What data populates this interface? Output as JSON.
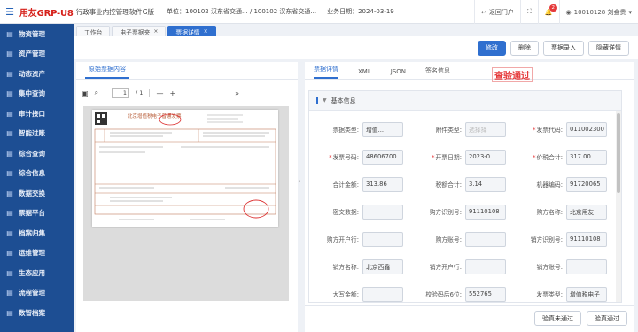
{
  "header": {
    "brand": "用友GRP-U8",
    "system": "行政事业内控管理软件G版",
    "unit": "单位：100102 汉东省交通... / 100102 汉东省交通...",
    "biz_date": "业务日期：2024-03-19",
    "back_portal": "返回门户",
    "notify_count": "2",
    "user": "10010128 刘金贵"
  },
  "sidebar": {
    "items": [
      {
        "label": "物资管理"
      },
      {
        "label": "资产管理"
      },
      {
        "label": "动态资产"
      },
      {
        "label": "集中查询"
      },
      {
        "label": "审计接口"
      },
      {
        "label": "智能过账"
      },
      {
        "label": "综合查询"
      },
      {
        "label": "综合信息"
      },
      {
        "label": "数据交换"
      },
      {
        "label": "票据平台"
      },
      {
        "label": "档案归集"
      },
      {
        "label": "运维管理"
      },
      {
        "label": "生态应用"
      },
      {
        "label": "流程管理"
      },
      {
        "label": "数智档案"
      }
    ]
  },
  "tabs": [
    {
      "label": "工作台"
    },
    {
      "label": "电子票据夹"
    },
    {
      "label": "票据详情"
    }
  ],
  "toolbar": {
    "edit": "修改",
    "delete": "删除",
    "entry": "票据录入",
    "hide": "隐藏详情"
  },
  "left": {
    "tab": "原始票据内容",
    "page_current": "1",
    "page_total": "/ 1"
  },
  "invoice": {
    "title": "北京增值税电子普通发票"
  },
  "right": {
    "tabs": [
      "票据详情",
      "XML",
      "JSON",
      "签名信息"
    ],
    "verify_badge": "查验通过",
    "section": "基本信息",
    "fields": [
      [
        {
          "label": "票据类型:",
          "value": "增值..."
        },
        {
          "label": "附件类型:",
          "value": "选择择",
          "ph": true
        },
        {
          "label": "发票代码:",
          "value": "011002300",
          "req": true
        }
      ],
      [
        {
          "label": "发票号码:",
          "value": "48606700",
          "req": true
        },
        {
          "label": "开票日期:",
          "value": "2023-0",
          "req": true
        },
        {
          "label": "价税合计:",
          "value": "317.00",
          "req": true
        }
      ],
      [
        {
          "label": "合计金额:",
          "value": "313.86"
        },
        {
          "label": "税额合计:",
          "value": "3.14"
        },
        {
          "label": "机器编码:",
          "value": "91720065"
        }
      ],
      [
        {
          "label": "密文数据:",
          "value": ""
        },
        {
          "label": "购方识别号:",
          "value": "91110108"
        },
        {
          "label": "购方名称:",
          "value": "北京用友"
        }
      ],
      [
        {
          "label": "购方开户行:",
          "value": ""
        },
        {
          "label": "购方账号:",
          "value": ""
        },
        {
          "label": "销方识别号:",
          "value": "91110108"
        }
      ],
      [
        {
          "label": "销方名称:",
          "value": "北京西鑫"
        },
        {
          "label": "销方开户行:",
          "value": ""
        },
        {
          "label": "销方账号:",
          "value": ""
        }
      ],
      [
        {
          "label": "大写金额:",
          "value": ""
        },
        {
          "label": "校验码后6位:",
          "value": "552765"
        },
        {
          "label": "发票类型:",
          "value": "增值税电子"
        }
      ]
    ],
    "footer": {
      "fail": "验真未通过",
      "pass": "验真通过"
    }
  }
}
